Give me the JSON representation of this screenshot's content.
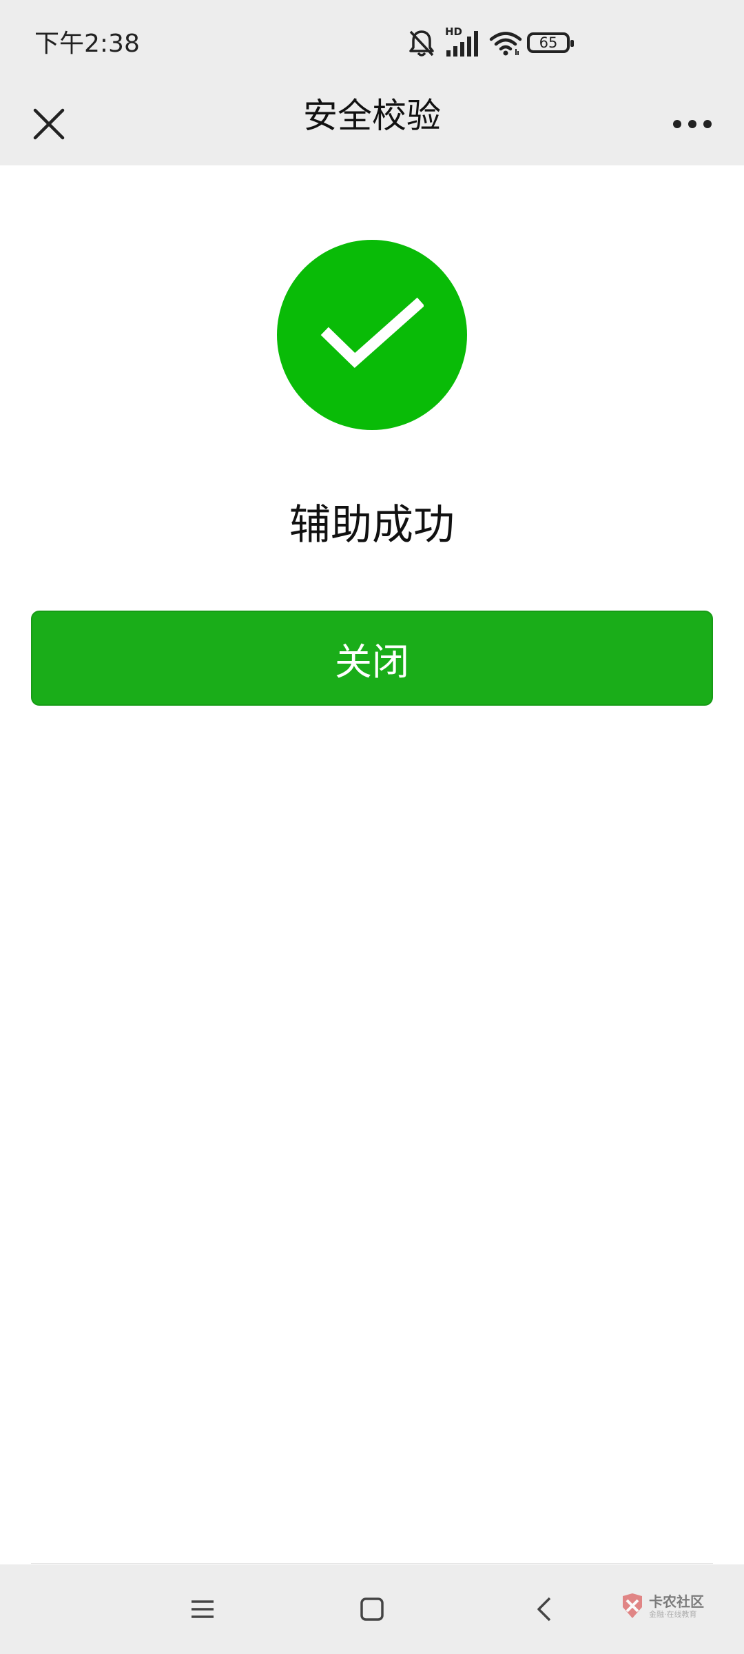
{
  "status_bar": {
    "time": "下午2:38",
    "network": "HD",
    "battery": "65",
    "icons": [
      "mute-bell-icon",
      "signal-icon",
      "wifi-icon",
      "battery-icon"
    ]
  },
  "nav": {
    "title": "安全校验",
    "close_icon": "close-icon",
    "more_icon": "more-icon"
  },
  "result": {
    "icon": "success-check-icon",
    "icon_color": "#09bb07",
    "message": "辅助成功"
  },
  "actions": {
    "close_label": "关闭",
    "button_color": "#1aad19"
  },
  "system_nav": {
    "icons": [
      "menu-icon",
      "home-icon",
      "back-icon"
    ]
  },
  "watermark": {
    "title": "卡农社区",
    "subtitle": "金融·在线教育"
  }
}
